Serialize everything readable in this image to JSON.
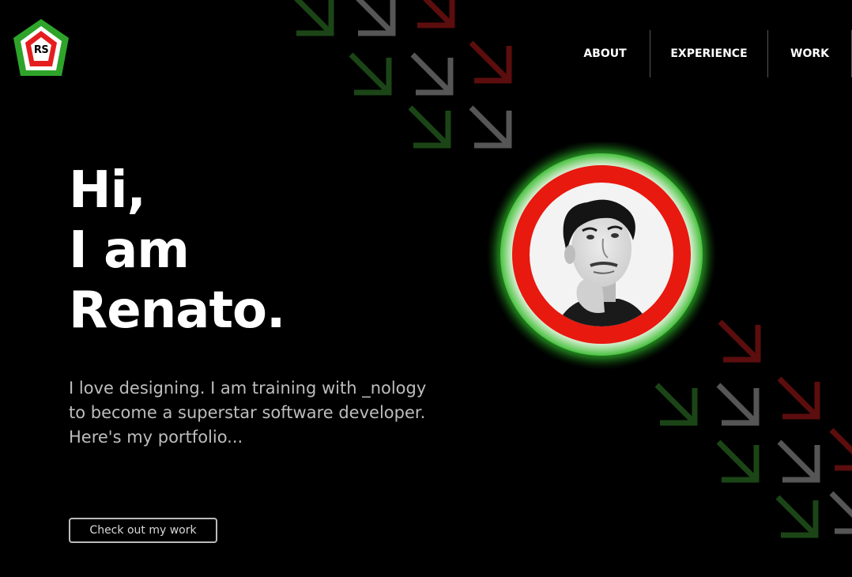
{
  "logo": {
    "text": "RS",
    "colors": {
      "outer": "#2ea42a",
      "middle": "#e41e1e",
      "inner": "#ffffff"
    }
  },
  "nav": {
    "items": [
      {
        "label": "ABOUT"
      },
      {
        "label": "EXPERIENCE"
      },
      {
        "label": "WORK"
      }
    ]
  },
  "hero": {
    "title_lines": [
      "Hi,",
      "I am",
      "Renato."
    ],
    "description": "I love designing. I am training with _nology to become a superstar software developer. Here's my portfolio...",
    "cta_label": "Check out my work"
  },
  "theme": {
    "background": "#000000",
    "accent_green": "#2db82a",
    "accent_red": "#e41e1e",
    "arrow_green": "#1c4a17",
    "arrow_gray": "#5a5a5a",
    "arrow_red": "#6b0f0f"
  },
  "icons": {
    "arrow": "arrow-down-right-icon",
    "avatar": "profile-photo"
  }
}
